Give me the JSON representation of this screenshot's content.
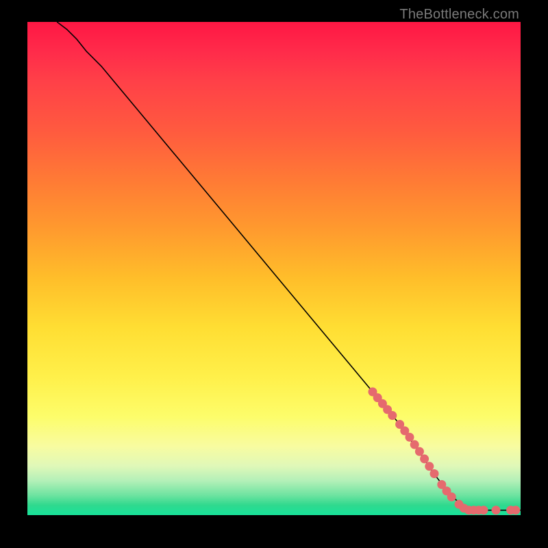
{
  "watermark": "TheBottleneck.com",
  "chart_data": {
    "type": "line",
    "title": "",
    "xlabel": "",
    "ylabel": "",
    "xlim": [
      0,
      100
    ],
    "ylim": [
      0,
      100
    ],
    "grid": false,
    "legend": false,
    "axis_ticks_visible": false,
    "background": "black_border_with_vertical_rainbow_gradient_plot_area",
    "gradient_stops": [
      {
        "pos": 0.0,
        "color": "#ff1744"
      },
      {
        "pos": 0.5,
        "color": "#ffbe2a"
      },
      {
        "pos": 0.8,
        "color": "#fdfd6a"
      },
      {
        "pos": 0.96,
        "color": "#6de3a0"
      },
      {
        "pos": 1.0,
        "color": "#18e29a"
      }
    ],
    "series": [
      {
        "name": "bottleneck-curve",
        "stroke": "#000000",
        "x": [
          6,
          8,
          10,
          12,
          15,
          20,
          30,
          40,
          50,
          60,
          70,
          75,
          80,
          82,
          85,
          88,
          90,
          92,
          95,
          98,
          100
        ],
        "y": [
          100,
          98.5,
          96.5,
          94,
          91,
          85,
          73,
          61,
          49,
          37,
          25,
          19,
          12,
          9,
          5,
          2,
          1,
          1,
          1,
          1,
          1
        ]
      }
    ],
    "markers": {
      "name": "highlighted-points",
      "color": "#e56a6e",
      "radius_px": 6,
      "points": [
        {
          "x": 70.0,
          "y": 25.0
        },
        {
          "x": 71.0,
          "y": 23.8
        },
        {
          "x": 72.0,
          "y": 22.6
        },
        {
          "x": 73.0,
          "y": 21.4
        },
        {
          "x": 74.0,
          "y": 20.2
        },
        {
          "x": 75.5,
          "y": 18.4
        },
        {
          "x": 76.5,
          "y": 17.1
        },
        {
          "x": 77.5,
          "y": 15.8
        },
        {
          "x": 78.5,
          "y": 14.3
        },
        {
          "x": 79.5,
          "y": 12.9
        },
        {
          "x": 80.5,
          "y": 11.4
        },
        {
          "x": 81.5,
          "y": 9.9
        },
        {
          "x": 82.5,
          "y": 8.4
        },
        {
          "x": 84.0,
          "y": 6.2
        },
        {
          "x": 85.0,
          "y": 4.9
        },
        {
          "x": 86.0,
          "y": 3.7
        },
        {
          "x": 87.5,
          "y": 2.2
        },
        {
          "x": 88.5,
          "y": 1.4
        },
        {
          "x": 89.5,
          "y": 1.0
        },
        {
          "x": 90.5,
          "y": 1.0
        },
        {
          "x": 91.5,
          "y": 1.0
        },
        {
          "x": 92.5,
          "y": 1.0
        },
        {
          "x": 95.0,
          "y": 1.0
        },
        {
          "x": 98.0,
          "y": 1.0
        },
        {
          "x": 99.0,
          "y": 1.0
        }
      ]
    }
  }
}
